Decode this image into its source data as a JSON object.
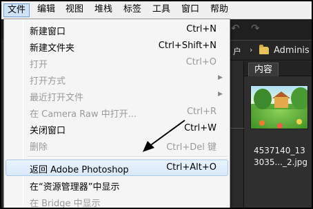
{
  "menubar": {
    "items": [
      {
        "label": "文件",
        "active": true
      },
      {
        "label": "编辑"
      },
      {
        "label": "视图"
      },
      {
        "label": "堆栈"
      },
      {
        "label": "标签"
      },
      {
        "label": "工具"
      },
      {
        "label": "窗口"
      },
      {
        "label": "帮助"
      }
    ]
  },
  "menu": {
    "items": [
      {
        "label": "新建窗口",
        "shortcut": "Ctrl+N"
      },
      {
        "label": "新建文件夹",
        "shortcut": "Ctrl+Shift+N"
      },
      {
        "label": "打开",
        "shortcut": "Ctrl+O",
        "disabled": true
      },
      {
        "label": "打开方式",
        "submenu": true,
        "disabled": true
      },
      {
        "label": "最近打开文件",
        "submenu": true,
        "disabled": true
      },
      {
        "label": "在 Camera Raw 中打开...",
        "shortcut": "Ctrl+R",
        "disabled": true
      },
      {
        "label": "关闭窗口",
        "shortcut": "Ctrl+W"
      },
      {
        "label": "删除",
        "shortcut": "Ctrl+Del 键",
        "disabled": true
      },
      {
        "label": "返回 Adobe Photoshop",
        "shortcut": "Ctrl+Alt+O",
        "highlighted": true
      },
      {
        "label": "在“资源管理器”中显示"
      },
      {
        "label": "在 Bridge 中显示",
        "disabled": true
      }
    ]
  },
  "background": {
    "path_prefix": "户",
    "path_separator": "›",
    "path_folder": "Adminis",
    "tab_label": "内容",
    "thumbnail_caption_line1": "4537140_13",
    "thumbnail_caption_line2": "3035..._2.jpg"
  },
  "colors": {
    "menu_highlight_border": "#a9c8ec",
    "menubar_active": "#cfe3f7",
    "bridge_bg": "#2b2b2b"
  },
  "icons": {
    "undo": "undo-icon",
    "redo": "redo-icon",
    "folder": "folder-icon",
    "submenu": "submenu-arrow-icon"
  }
}
